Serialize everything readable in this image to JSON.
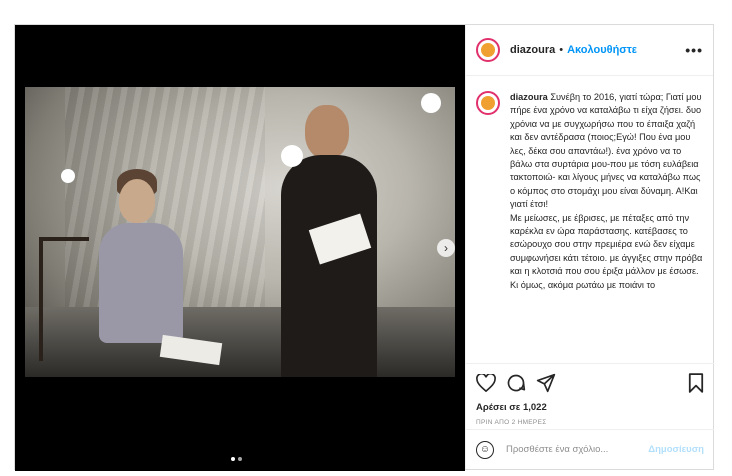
{
  "post": {
    "username": "diazoura",
    "separator": "•",
    "follow_label": "Ακολουθήστε",
    "more_icon": "more-horizontal-icon",
    "caption": "Συνέβη το 2016, γιατί τώρα; Γιατί μου πήρε ένα χρόνο να καταλάβω τι είχα ζήσει. δυο χρόνια να με συγχωρήσω που το έπαιξα χαζή και δεν αντέδρασα (ποιος;Εγώ! Που ένα μου λες, δέκα σου απαντάω!). ένα χρόνο να το βάλω στα συρτάρια μου-που με τόση ευλάβεια τακτοποιώ- και λίγους μήνες να καταλάβω πως ο κόμπος στο στομάχι μου είναι δύναμη. Α!Και γιατί έτσι!\nΜε μείωσες, με έβρισες, με πέταξες από την καρέκλα εν ώρα παράστασης. κατέβασες το εσώρουχο σου στην πρεμιέρα ενώ δεν είχαμε συμφωνήσει κάτι τέτοιο. με άγγιξες στην πρόβα και η κλοτσιά που σου έριξα μάλλον με έσωσε. Κι όμως, ακόμα ρωτάω με ποιάνι το",
    "likes": "Αρέσει σε 1,022",
    "timestamp": "ΠΡΙΝ ΑΠΟ 2 ΗΜΕΡΕΣ",
    "comment_placeholder": "Προσθέστε ένα σχόλιο...",
    "post_label": "Δημοσίευση"
  },
  "media": {
    "carousel_total": 2,
    "carousel_active": 1,
    "next_icon": "chevron-right-icon"
  },
  "colors": {
    "accent": "#0095f6",
    "post_button_disabled": "#b2dffc",
    "border": "#dbdbdb"
  }
}
